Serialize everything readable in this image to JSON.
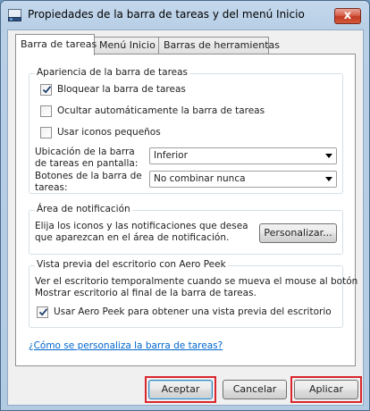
{
  "window": {
    "title": "Propiedades de la barra de tareas y del menú Inicio",
    "close_glyph": "x",
    "icon": "taskbar-properties-icon"
  },
  "tabs": [
    {
      "label": "Barra de tareas",
      "active": true
    },
    {
      "label": "Menú Inicio",
      "active": false
    },
    {
      "label": "Barras de herramientas",
      "active": false
    }
  ],
  "appearance": {
    "title": "Apariencia de la barra de tareas",
    "lock_taskbar": {
      "label": "Bloquear la barra de tareas",
      "checked": true
    },
    "autohide": {
      "label": "Ocultar automáticamente la barra de tareas",
      "checked": false
    },
    "small_icons": {
      "label": "Usar iconos pequeños",
      "checked": false
    },
    "location_label": "Ubicación de la barra de tareas en pantalla:",
    "location_value": "Inferior",
    "buttons_label": "Botones de la barra de tareas:",
    "buttons_value": "No combinar nunca"
  },
  "notification": {
    "title": "Área de notificación",
    "text": "Elija los iconos y las notificaciones que desea que aparezcan en el área de notificación.",
    "customize_label": "Personalizar..."
  },
  "aero_peek": {
    "title": "Vista previa del escritorio con Aero Peek",
    "text_line1": "Ver el escritorio temporalmente cuando se mueva el mouse al botón",
    "text_line2": "Mostrar escritorio al final de la barra de tareas.",
    "use_peek": {
      "label": "Usar Aero Peek para obtener una vista previa del escritorio",
      "checked": true
    }
  },
  "help_link": "¿Cómo se personaliza la barra de tareas?",
  "footer": {
    "ok_label": "Aceptar",
    "cancel_label": "Cancelar",
    "apply_label": "Aplicar"
  },
  "colors": {
    "highlight": "#d9262c",
    "link": "#0066cc"
  }
}
